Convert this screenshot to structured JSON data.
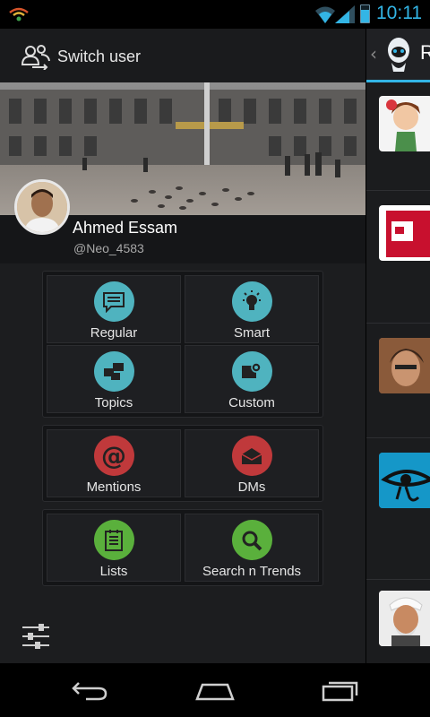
{
  "status_bar": {
    "time": "10:11",
    "battery_level": 0.75
  },
  "drawer": {
    "switch_user_label": "Switch user",
    "user_name": "Ahmed Essam",
    "user_handle": "@Neo_4583",
    "groups": [
      [
        {
          "label": "Regular",
          "icon": "regular-icon",
          "color": "#4fb3bf"
        },
        {
          "label": "Smart",
          "icon": "lightbulb-icon",
          "color": "#4fb3bf"
        },
        {
          "label": "Topics",
          "icon": "topics-icon",
          "color": "#4fb3bf"
        },
        {
          "label": "Custom",
          "icon": "custom-gear-icon",
          "color": "#4fb3bf"
        }
      ],
      [
        {
          "label": "Mentions",
          "icon": "at-icon",
          "color": "#c0393b"
        },
        {
          "label": "DMs",
          "icon": "envelope-icon",
          "color": "#c0393b"
        }
      ],
      [
        {
          "label": "Lists",
          "icon": "list-icon",
          "color": "#5ab03c"
        },
        {
          "label": "Search n Trends",
          "icon": "search-icon",
          "color": "#5ab03c"
        }
      ]
    ]
  },
  "content": {
    "header_title_fragment": "R"
  },
  "colors": {
    "accent": "#33b5e5",
    "teal": "#4fb3bf",
    "red": "#c0393b",
    "green": "#5ab03c"
  }
}
